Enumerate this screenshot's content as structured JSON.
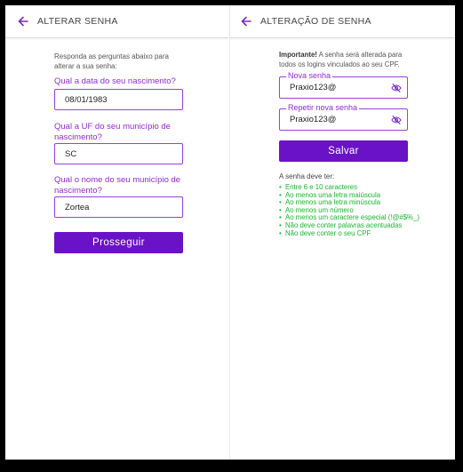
{
  "left": {
    "header_title": "ALTERAR SENHA",
    "intro": "Responda as perguntas abaixo para alterar a sua senha:",
    "q1_label": "Qual a data do seu nascimento?",
    "q1_value": "08/01/1983",
    "q2_label": "Qual a UF do seu município de nascimento?",
    "q2_value": "SC",
    "q3_label": "Qual o nome do seu município de nascimento?",
    "q3_value": "Zortea",
    "proceed_label": "Prosseguir"
  },
  "right": {
    "header_title": "ALTERAÇÃO DE SENHA",
    "important_bold": "Importante!",
    "important_text": " A senha será alterada para todos os logins vinculados ao seu CPF.",
    "new_password_label": "Nova senha",
    "new_password_value": "Praxio123@",
    "repeat_password_label": "Repetir nova senha",
    "repeat_password_value": "Praxio123@",
    "save_label": "Salvar",
    "rules_title": "A senha deve ter:",
    "rules": [
      "Entre 6 e 10 caracteres",
      "Ao menos uma letra maiúscula",
      "Ao menos uma letra minúscula",
      "Ao menos um número",
      "Ao menos um caractere especial (!@#$%_)",
      "Não deve conter palavras acentuadas",
      "Não deve conter o seu CPF"
    ]
  },
  "colors": {
    "accent": "#6a12c7",
    "label": "#8e2bd0",
    "rule_green": "#19b530"
  },
  "icons": {
    "back": "arrow-left-icon",
    "visibility": "eye-off-icon"
  }
}
